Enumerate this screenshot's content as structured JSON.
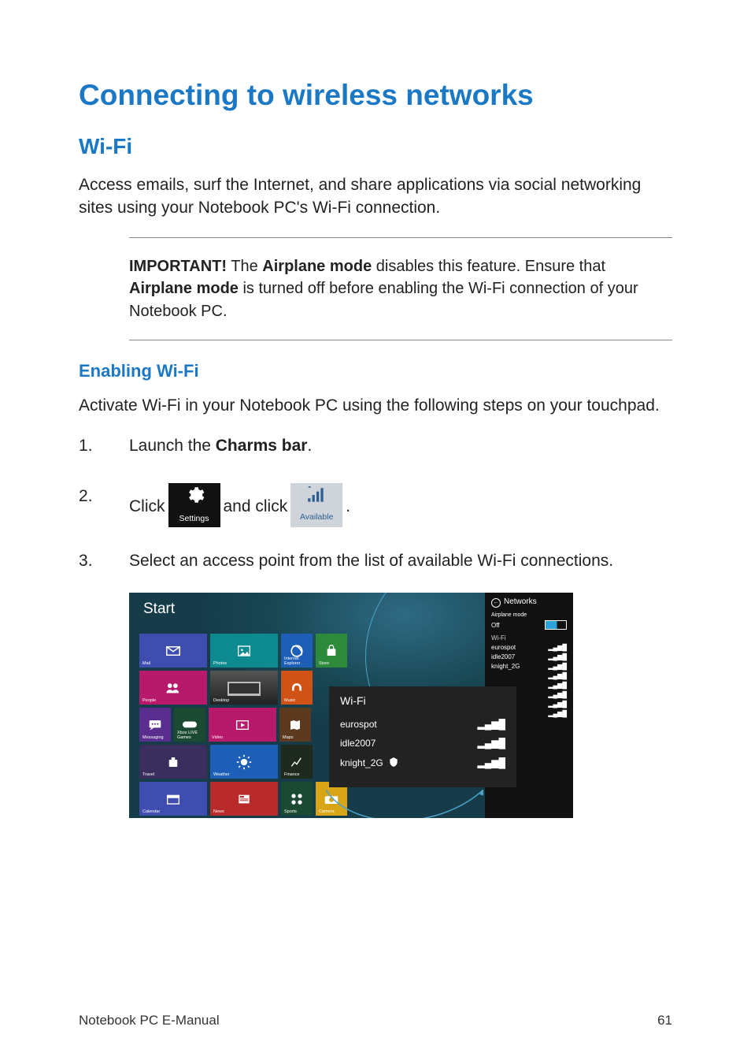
{
  "heading": "Connecting to wireless networks",
  "section_wifi": "Wi-Fi",
  "intro": "Access emails, surf the Internet, and share applications via social networking sites using your Notebook PC's Wi-Fi connection.",
  "important_label": "IMPORTANT!",
  "important_part1": " The ",
  "important_bold1": "Airplane mode",
  "important_part2": " disables this feature. Ensure that ",
  "important_bold2": "Airplane mode",
  "important_part3": " is turned off before enabling the Wi-Fi connection of your Notebook PC.",
  "enabling_heading": "Enabling Wi-Fi",
  "enabling_intro": "Activate Wi-Fi in your Notebook PC using the following steps on your touchpad.",
  "steps": {
    "one_pre": "Launch the ",
    "one_bold": "Charms bar",
    "one_post": ".",
    "two_pre": "Click ",
    "two_mid": " and click ",
    "two_post": ".",
    "three": "Select an access point from the list of available Wi-Fi connections."
  },
  "tile_settings_label": "Settings",
  "tile_available_label": "Available",
  "screenshot": {
    "start_label": "Start",
    "tiles": [
      {
        "label": "Mail",
        "icon": "mail",
        "color": "c-indigo",
        "w": "sz-w"
      },
      {
        "label": "Photos",
        "icon": "photo",
        "color": "c-teal",
        "w": "sz-w"
      },
      {
        "label": "Internet Explorer",
        "icon": "ie",
        "color": "c-blue",
        "w": "sz-s"
      },
      {
        "label": "Store",
        "icon": "store",
        "color": "c-green",
        "w": "sz-s"
      },
      {
        "label": "People",
        "icon": "people",
        "color": "c-mag",
        "w": "sz-w"
      },
      {
        "label": "Desktop",
        "icon": "desktop",
        "color": "c-desk",
        "w": "sz-w"
      },
      {
        "label": "Music",
        "icon": "music",
        "color": "c-orange",
        "w": "sz-s"
      },
      {
        "label": "Messaging",
        "icon": "msg",
        "color": "c-purple",
        "w": "sz-s"
      },
      {
        "label": "Xbox LIVE Games",
        "icon": "game",
        "color": "c-dkgrn",
        "w": "sz-s"
      },
      {
        "label": "Video",
        "icon": "video",
        "color": "c-pink",
        "w": "sz-w"
      },
      {
        "label": "Maps",
        "icon": "maps",
        "color": "c-brown",
        "w": "sz-s"
      },
      {
        "label": "Travel",
        "icon": "travel",
        "color": "c-dkprp",
        "w": "sz-w"
      },
      {
        "label": "Weather",
        "icon": "weather",
        "color": "c-blue",
        "w": "sz-w"
      },
      {
        "label": "Finance",
        "icon": "finance",
        "color": "c-dark",
        "w": "sz-s"
      },
      {
        "label": "Calendar",
        "icon": "calendar",
        "color": "c-indigo",
        "w": "sz-w"
      },
      {
        "label": "News",
        "icon": "news",
        "color": "c-red",
        "w": "sz-w"
      },
      {
        "label": "Sports",
        "icon": "sports",
        "color": "c-dkgrn",
        "w": "sz-s"
      },
      {
        "label": "Camera",
        "icon": "camera",
        "color": "c-yel",
        "w": "sz-s"
      }
    ],
    "networks_panel": {
      "title": "Networks",
      "airplane_label": "Airplane mode",
      "airplane_state": "Off",
      "section": "Wi-Fi",
      "items": [
        "eurospot",
        "idle2007",
        "knight_2G"
      ]
    },
    "wifi_popup": {
      "title": "Wi-Fi",
      "items": [
        "eurospot",
        "idle2007",
        "knight_2G"
      ]
    }
  },
  "footer_left": "Notebook PC E-Manual",
  "footer_right": "61"
}
